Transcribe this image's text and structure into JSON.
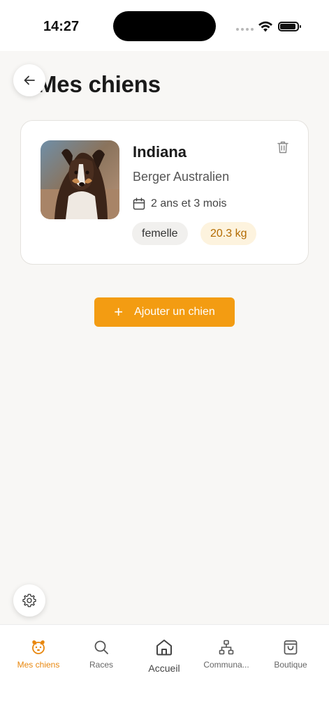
{
  "status_bar": {
    "time": "14:27"
  },
  "page": {
    "title": "Mes chiens"
  },
  "dog": {
    "name": "Indiana",
    "breed": "Berger Australien",
    "age": "2 ans et 3 mois",
    "sex": "femelle",
    "weight": "20.3 kg"
  },
  "actions": {
    "add_dog_label": "Ajouter un chien"
  },
  "tab_bar": {
    "items": [
      {
        "label": "Mes chiens",
        "icon": "dog-face-icon",
        "active": true
      },
      {
        "label": "Races",
        "icon": "search-icon",
        "active": false
      },
      {
        "label": "Accueil",
        "icon": "home-icon",
        "active": false
      },
      {
        "label": "Communa...",
        "icon": "community-network-icon",
        "active": false
      },
      {
        "label": "Boutique",
        "icon": "shopping-bag-icon",
        "active": false
      }
    ]
  },
  "colors": {
    "accent": "#f39c12",
    "active_tab": "#e8870e",
    "weight_chip_bg": "#fdf3de"
  }
}
